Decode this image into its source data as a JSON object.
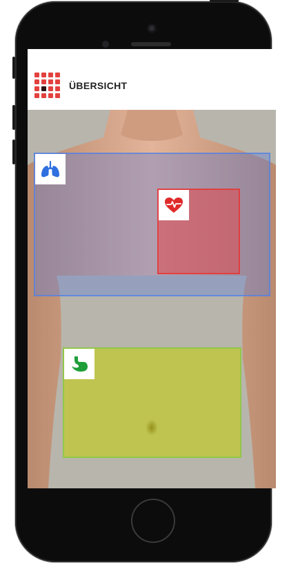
{
  "header": {
    "title": "ÜBERSICHT",
    "menu_icon": "grid-menu-icon"
  },
  "regions": [
    {
      "id": "lungs",
      "icon": "lungs-icon",
      "color": "#2f6fe0"
    },
    {
      "id": "heart",
      "icon": "heart-pulse-icon",
      "color": "#e02a2a"
    },
    {
      "id": "stomach",
      "icon": "stomach-icon",
      "color": "#1f9e3a"
    }
  ],
  "colors": {
    "accent": "#e3413e",
    "lungs": "#2f6fe0",
    "heart": "#e02a2a",
    "stomach": "#1f9e3a"
  }
}
